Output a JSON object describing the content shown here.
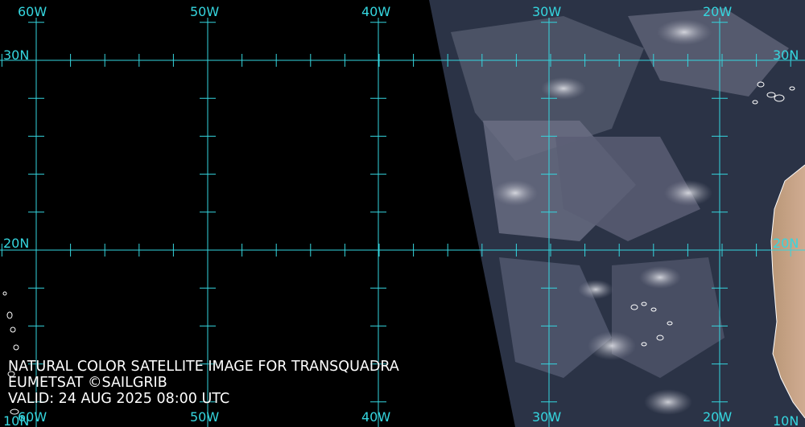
{
  "map": {
    "longitude_labels": [
      "60W",
      "50W",
      "40W",
      "30W",
      "20W"
    ],
    "latitude_labels_left": [
      "30N",
      "20N",
      "10N"
    ],
    "latitude_labels_right": [
      "30N",
      "20N",
      "10N"
    ],
    "grid_color": "#35d6df",
    "coastline_color": "#ffffff",
    "no_data_color": "#000000"
  },
  "caption": {
    "line1": "NATURAL COLOR SATELLITE IMAGE FOR TRANSQUADRA",
    "line2": "EUMETSAT ©SAILGRIB",
    "line3": "VALID:  24 AUG 2025 08:00 UTC"
  }
}
